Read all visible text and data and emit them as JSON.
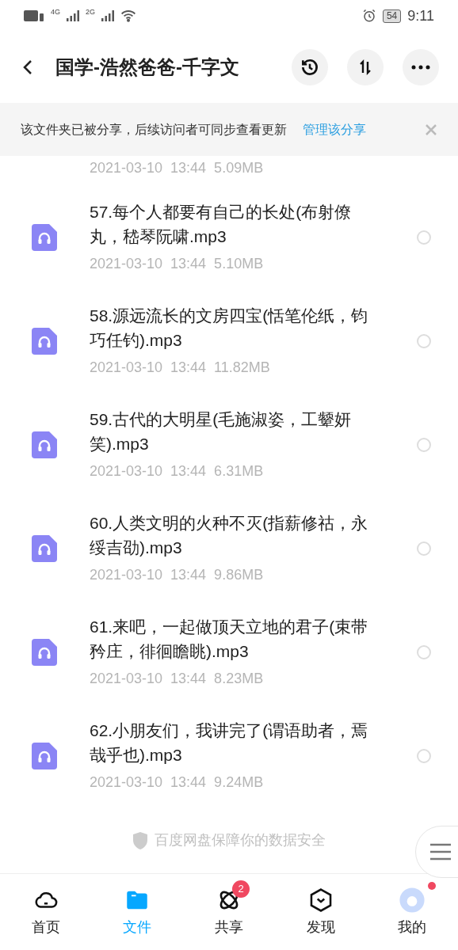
{
  "status_bar": {
    "network_1": "4G",
    "network_2": "2G",
    "battery": "54",
    "time": "9:11"
  },
  "header": {
    "title": "国学-浩然爸爸-千字文"
  },
  "banner": {
    "text": "该文件夹已被分享，后续访问者可同步查看更新",
    "link": "管理该分享"
  },
  "partial_row": {
    "date": "2021-03-10",
    "time": "13:44",
    "size": "5.09MB"
  },
  "files": [
    {
      "name": "57.每个人都要有自己的长处(布射僚丸，嵇琴阮啸.mp3",
      "date": "2021-03-10",
      "time": "13:44",
      "size": "5.10MB",
      "selected": false
    },
    {
      "name": "58.源远流长的文房四宝(恬笔伦纸，钧巧任钓).mp3",
      "date": "2021-03-10",
      "time": "13:44",
      "size": "11.82MB",
      "selected": false
    },
    {
      "name": "59.古代的大明星(毛施淑姿，工颦妍笑).mp3",
      "date": "2021-03-10",
      "time": "13:44",
      "size": "6.31MB",
      "selected": false
    },
    {
      "name": "60.人类文明的火种不灭(指薪修祜，永绥吉劭).mp3",
      "date": "2021-03-10",
      "time": "13:44",
      "size": "9.86MB",
      "selected": false
    },
    {
      "name": "61.来吧，一起做顶天立地的君子(束带矜庄，徘徊瞻眺).mp3",
      "date": "2021-03-10",
      "time": "13:44",
      "size": "8.23MB",
      "selected": false
    },
    {
      "name": "62.小朋友们，我讲完了(谓语助者，焉哉乎也).mp3",
      "date": "2021-03-10",
      "time": "13:44",
      "size": "9.24MB",
      "selected": false
    }
  ],
  "footer_note": "百度网盘保障你的数据安全",
  "tabs": [
    {
      "kind": "home",
      "label": "首页",
      "selected": false
    },
    {
      "kind": "files",
      "label": "文件",
      "selected": true
    },
    {
      "kind": "share",
      "label": "共享",
      "selected": false,
      "badge": "2"
    },
    {
      "kind": "discover",
      "label": "发现",
      "selected": false
    },
    {
      "kind": "me",
      "label": "我的",
      "selected": false,
      "dot": true
    }
  ]
}
